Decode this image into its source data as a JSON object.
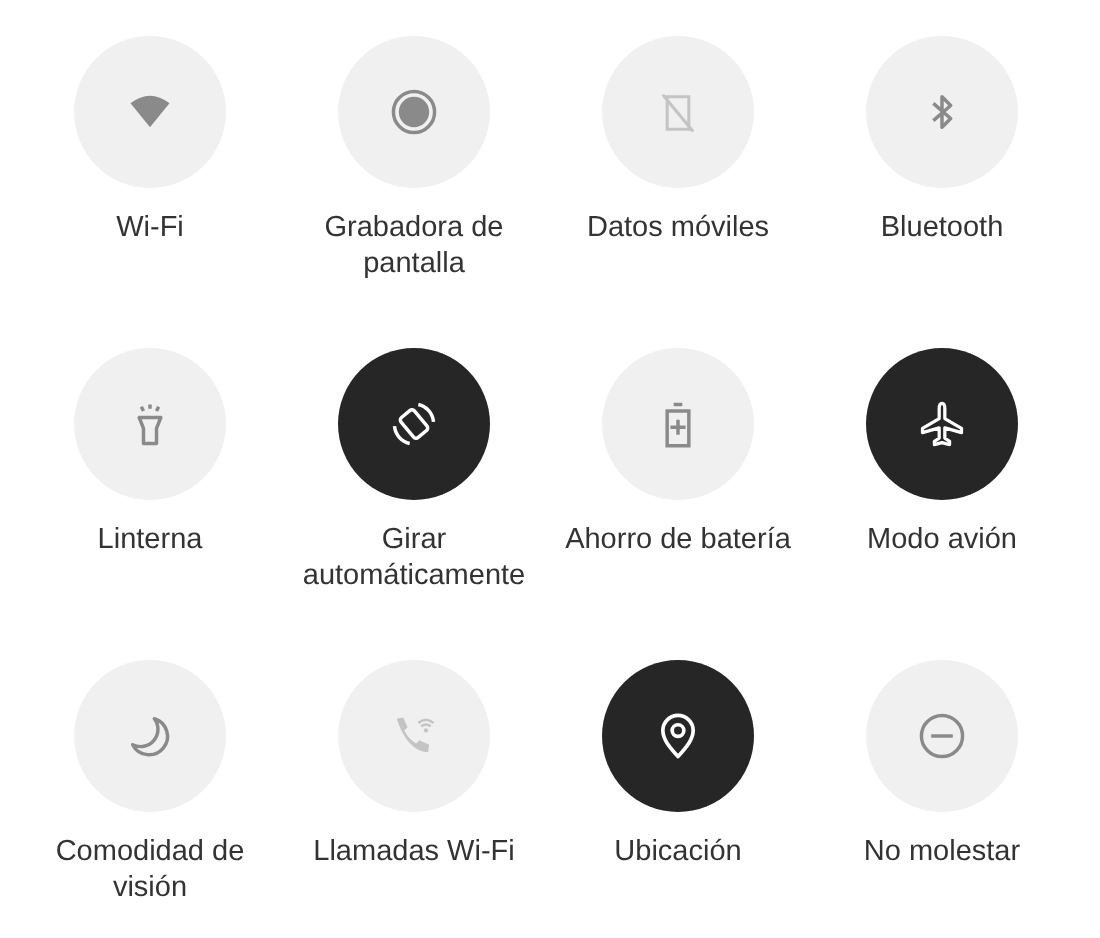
{
  "tiles": [
    {
      "label": "Wi-Fi",
      "on": false,
      "disabled": false
    },
    {
      "label": "Grabadora de pantalla",
      "on": false,
      "disabled": false
    },
    {
      "label": "Datos móviles",
      "on": false,
      "disabled": true
    },
    {
      "label": "Bluetooth",
      "on": false,
      "disabled": false
    },
    {
      "label": "Linterna",
      "on": false,
      "disabled": false
    },
    {
      "label": "Girar automáticamente",
      "on": true,
      "disabled": false
    },
    {
      "label": "Ahorro de batería",
      "on": false,
      "disabled": false
    },
    {
      "label": "Modo avión",
      "on": true,
      "disabled": false
    },
    {
      "label": "Comodidad de visión",
      "on": false,
      "disabled": false
    },
    {
      "label": "Llamadas Wi-Fi",
      "on": false,
      "disabled": true
    },
    {
      "label": "Ubicación",
      "on": true,
      "disabled": false
    },
    {
      "label": "No molestar",
      "on": false,
      "disabled": false
    }
  ]
}
